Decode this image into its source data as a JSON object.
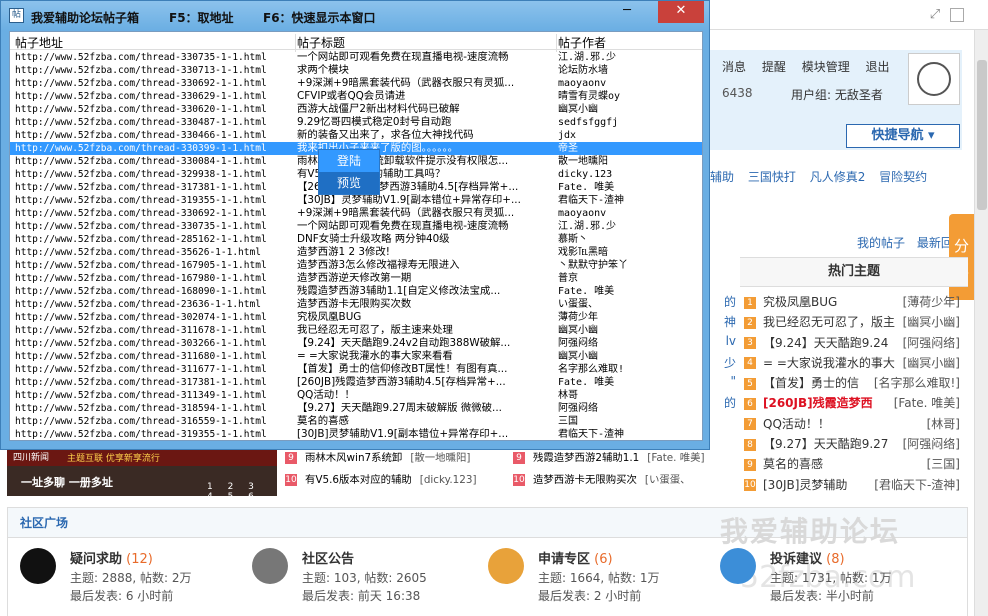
{
  "window": {
    "title": "我爱辅助论坛帖子箱",
    "hotkey1": "F5：取地址",
    "hotkey2": "F6：快速显示本窗口",
    "min_label": "─",
    "max_label": "□",
    "close_label": "✕"
  },
  "list": {
    "col_url": "帖子地址",
    "col_title": "帖子标题",
    "col_author": "帖子作者",
    "rows": [
      {
        "u": "http://www.52fzba.com/thread-330735-1-1.html",
        "t": "一个网站即可观看免费在现直播电视-速度流畅",
        "a": "江.湖.邪.少"
      },
      {
        "u": "http://www.52fzba.com/thread-330713-1-1.html",
        "t": "求两个模块",
        "a": "论坛防水墙"
      },
      {
        "u": "http://www.52fzba.com/thread-330692-1-1.html",
        "t": "+9深渊+9暗黑套装代码（武器衣服只有灵狐...",
        "a": "maoyaonv"
      },
      {
        "u": "http://www.52fzba.com/thread-330629-1-1.html",
        "t": "CFVIP或者QQ会员请进",
        "a": "晴雪有灵蝶oy"
      },
      {
        "u": "http://www.52fzba.com/thread-330620-1-1.html",
        "t": "西游大战僵尸2新出材料代码已破解",
        "a": "幽冥小幽"
      },
      {
        "u": "http://www.52fzba.com/thread-330487-1-1.html",
        "t": "9.29忆哥四模式稳定0封号自动跑",
        "a": "sedfsfggfj"
      },
      {
        "u": "http://www.52fzba.com/thread-330466-1-1.html",
        "t": "新的装备又出来了，求各位大神找代码",
        "a": "jdx"
      },
      {
        "u": "http://www.52fzba.com/thread-330399-1-1.html",
        "t": "我来扣出小子来来了版的图。。。。。。",
        "a": "帝圣"
      },
      {
        "u": "http://www.52fzba.com/thread-330084-1-1.html",
        "t": "雨林木风win7系统卸载软件提示没有权限怎...",
        "a": "散一地曛阳"
      },
      {
        "u": "http://www.52fzba.com/thread-329938-1-1.html",
        "t": "有V5.6版本对应的辅助工具吗？",
        "a": "dicky.123"
      },
      {
        "u": "http://www.52fzba.com/thread-317381-1-1.html",
        "t": "【260JB】残酸造梦西游3辅助4.5[存档异常+...",
        "a": "Fate. 唯美"
      },
      {
        "u": "http://www.52fzba.com/thread-319355-1-1.html",
        "t": "【30JB】灵梦辅助V1.9[副本错位+异常存印+...",
        "a": "君临天下-渣神"
      },
      {
        "u": "http://www.52fzba.com/thread-330692-1-1.html",
        "t": "+9深渊+9暗黑套装代码（武器衣服只有灵狐...",
        "a": "maoyaonv"
      },
      {
        "u": "http://www.52fzba.com/thread-330735-1-1.html",
        "t": "一个网站即可观看免费在现直播电视-速度流畅",
        "a": "江.湖.邪.少"
      },
      {
        "u": "http://www.52fzba.com/thread-285162-1-1.html",
        "t": "DNF女骑士升级攻略 两分钟40级",
        "a": "慕斯丶"
      },
      {
        "u": "http://www.52fzba.com/thread-35626-1-1.html",
        "t": "造梦西游1 2 3修改!",
        "a": "戏影℡黑暗"
      },
      {
        "u": "http://www.52fzba.com/thread-167905-1-1.html",
        "t": "造梦西游3怎么修改福禄寿无限进入",
        "a": "丶默默守护笨丫"
      },
      {
        "u": "http://www.52fzba.com/thread-167980-1-1.html",
        "t": "造梦西游逆天修改第一期",
        "a": "普京"
      },
      {
        "u": "http://www.52fzba.com/thread-168090-1-1.html",
        "t": "残霞造梦西游3辅助1.1[自定义修改法宝成...",
        "a": "Fate. 唯美"
      },
      {
        "u": "http://www.52fzba.com/thread-23636-1-1.html",
        "t": "造梦西游卡无限购买次数",
        "a": "い蛋蛋、"
      },
      {
        "u": "http://www.52fzba.com/thread-302074-1-1.html",
        "t": "究极凤凰BUG",
        "a": "薄荷少年"
      },
      {
        "u": "http://www.52fzba.com/thread-311678-1-1.html",
        "t": "我已经忍无可忍了，版主速来处理",
        "a": "幽冥小幽"
      },
      {
        "u": "http://www.52fzba.com/thread-303266-1-1.html",
        "t": "【9.24】天天酷跑9.24ⅴ2自动跑388W破解...",
        "a": "阿强闷络"
      },
      {
        "u": "http://www.52fzba.com/thread-311680-1-1.html",
        "t": "= =大家说我灌水的事大家来看看",
        "a": "幽冥小幽"
      },
      {
        "u": "http://www.52fzba.com/thread-311677-1-1.html",
        "t": "【首发】勇士的信仰修改BT属性！有图有真...",
        "a": "名字那么难取!"
      },
      {
        "u": "http://www.52fzba.com/thread-317381-1-1.html",
        "t": "[260JB]残霞造梦西游3辅助4.5[存档异常+...",
        "a": "Fate. 唯美"
      },
      {
        "u": "http://www.52fzba.com/thread-311349-1-1.html",
        "t": "QQ活动！！",
        "a": "林哥"
      },
      {
        "u": "http://www.52fzba.com/thread-318594-1-1.html",
        "t": "【9.27】天天酷跑9.27周末破解版 微微破...",
        "a": "阿强闷络"
      },
      {
        "u": "http://www.52fzba.com/thread-316559-1-1.html",
        "t": "莫名的喜感",
        "a": "三国"
      },
      {
        "u": "http://www.52fzba.com/thread-319355-1-1.html",
        "t": "[30JB]灵梦辅助V1.9[副本错位+异常存印+...",
        "a": "君临天下-渣神"
      }
    ],
    "selected_index": 7
  },
  "context_menu": {
    "items": [
      "登陆",
      "预览"
    ],
    "hovered_index": 1
  },
  "bg": {
    "nav": [
      "消息",
      "提醒",
      "模块管理",
      "退出"
    ],
    "stat_num": "6438",
    "usergroup": "用户组: 无敌圣者",
    "quicknav": "快捷导航 ▾",
    "game_links": [
      "辅助",
      "三国快打",
      "凡人修真2",
      "冒险契约"
    ],
    "my_links": [
      "我的帖子",
      "最新回"
    ],
    "share": "分享",
    "hot_title": "热门主题",
    "hot": [
      {
        "t": "究极凤凰BUG",
        "a": "[薄荷少年]"
      },
      {
        "t": "我已经忍无可忍了，版主",
        "a": "[幽冥小幽]"
      },
      {
        "t": "【9.24】天天酷跑9.24",
        "a": "[阿强闷络]"
      },
      {
        "t": "= =大家说我灌水的事大",
        "a": "[幽冥小幽]"
      },
      {
        "t": "【首发】勇士的信",
        "a": "[名字那么难取!]"
      },
      {
        "t": "[260JB]残霞造梦西",
        "a": "[Fate. 唯美]"
      },
      {
        "t": "QQ活动！！",
        "a": "[林哥]"
      },
      {
        "t": "【9.27】天天酷跑9.27",
        "a": "[阿强闷络]"
      },
      {
        "t": "莫名的喜感",
        "a": "[三国]"
      },
      {
        "t": "[30JB]灵梦辅助",
        "a": "[君临天下-渣神]"
      }
    ],
    "hot_nums": [
      "1",
      "2",
      "3",
      "4",
      "5",
      "6",
      "7",
      "8",
      "9",
      "10"
    ],
    "left_stub": [
      "的",
      "神",
      "lv",
      "少",
      "\"",
      "的",
      "",
      ""
    ],
    "banner_t1": "四川新闻",
    "banner_t2": "主题互联 优享新享流行",
    "banner_t3": "一址多聊  一册多址",
    "banner_dots": "1 2 3 4 5 6",
    "mid1": [
      {
        "n": "9",
        "t": "雨林木风win7系统卸",
        "a": "[散一地曛阳]"
      },
      {
        "n": "10",
        "t": "有V5.6版本对应的辅助",
        "a": "[dicky.123]"
      }
    ],
    "mid2": [
      {
        "n": "9",
        "t": "残霞造梦西游2辅助1.1",
        "a": "[Fate. 唯美]"
      },
      {
        "n": "10",
        "t": "造梦西游卡无限购买次",
        "a": "[い蛋蛋、"
      }
    ],
    "community_title": "社区广场",
    "watermark": "我爱辅助论坛",
    "watermark2": "52fzba.com",
    "forums": [
      {
        "name": "疑问求助",
        "cnt": "(12)",
        "l1": "主题: 2888, 帖数: 2万",
        "l2": "最后发表: 6 小时前",
        "color": "#111"
      },
      {
        "name": "社区公告",
        "cnt": "",
        "l1": "主题: 103, 帖数: 2605",
        "l2": "最后发表: 前天 16:38",
        "color": "#777"
      },
      {
        "name": "申请专区",
        "cnt": "(6)",
        "l1": "主题: 1664, 帖数: 1万",
        "l2": "最后发表: 2 小时前",
        "color": "#e8a23a"
      },
      {
        "name": "投诉建议",
        "cnt": "(8)",
        "l1": "主题: 1731, 帖数: 1万",
        "l2": "最后发表: 半小时前",
        "color": "#3c8ed8"
      }
    ]
  }
}
